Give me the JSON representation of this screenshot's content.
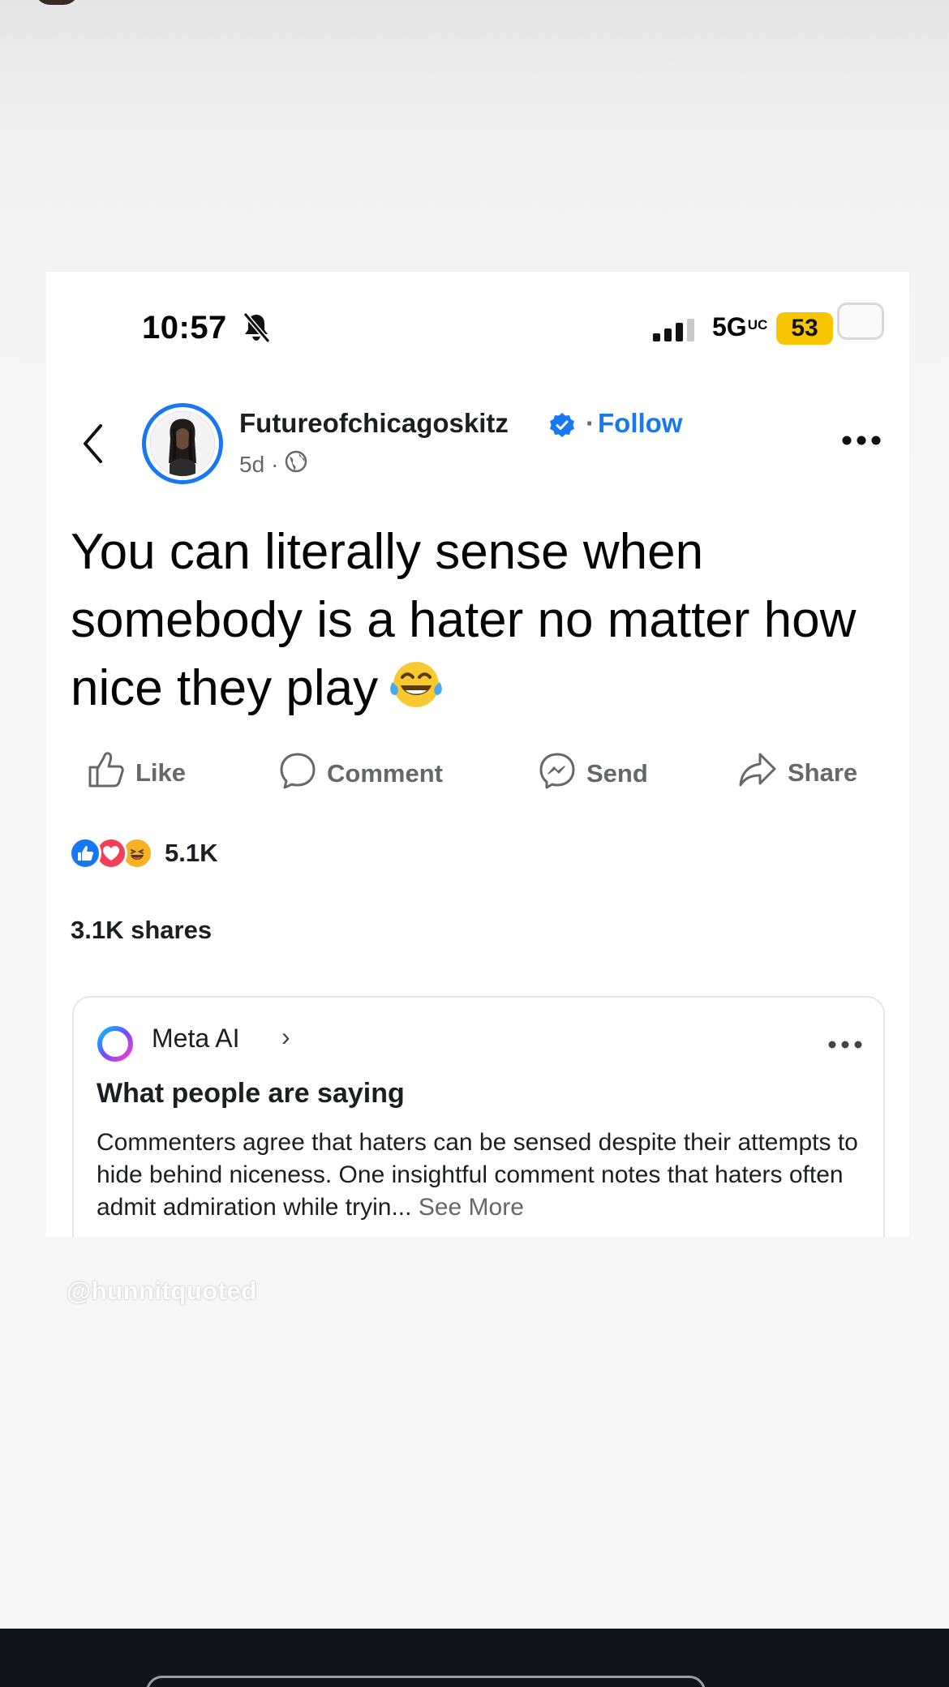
{
  "status_bar": {
    "time": "10:57",
    "network": "5G",
    "network_suffix": "UC",
    "battery": "53",
    "icons": [
      "bell-muted-icon",
      "signal-bars-icon"
    ]
  },
  "post": {
    "author": "Futureofchicagoskitz",
    "follow_label": "Follow",
    "age": "5d",
    "audience_icon": "globe-icon",
    "text": "You can literally sense when somebody is a hater no matter how nice they play"
  },
  "actions": {
    "like": "Like",
    "comment": "Comment",
    "send": "Send",
    "share": "Share"
  },
  "stats": {
    "reactions_count": "5.1K",
    "reaction_types": [
      "like",
      "love",
      "haha"
    ],
    "shares": "3.1K shares"
  },
  "meta_ai": {
    "name": "Meta AI",
    "title": "What people are saying",
    "summary": "Commenters agree that haters can be sensed despite their attempts to hide behind niceness. One insightful comment notes that haters often admit admiration while tryin...",
    "see_more": "See More"
  },
  "watermark": "@hunnitquoted",
  "colors": {
    "accent": "#1877f2",
    "battery": "#f7c600",
    "secondary_text": "#65676b"
  }
}
